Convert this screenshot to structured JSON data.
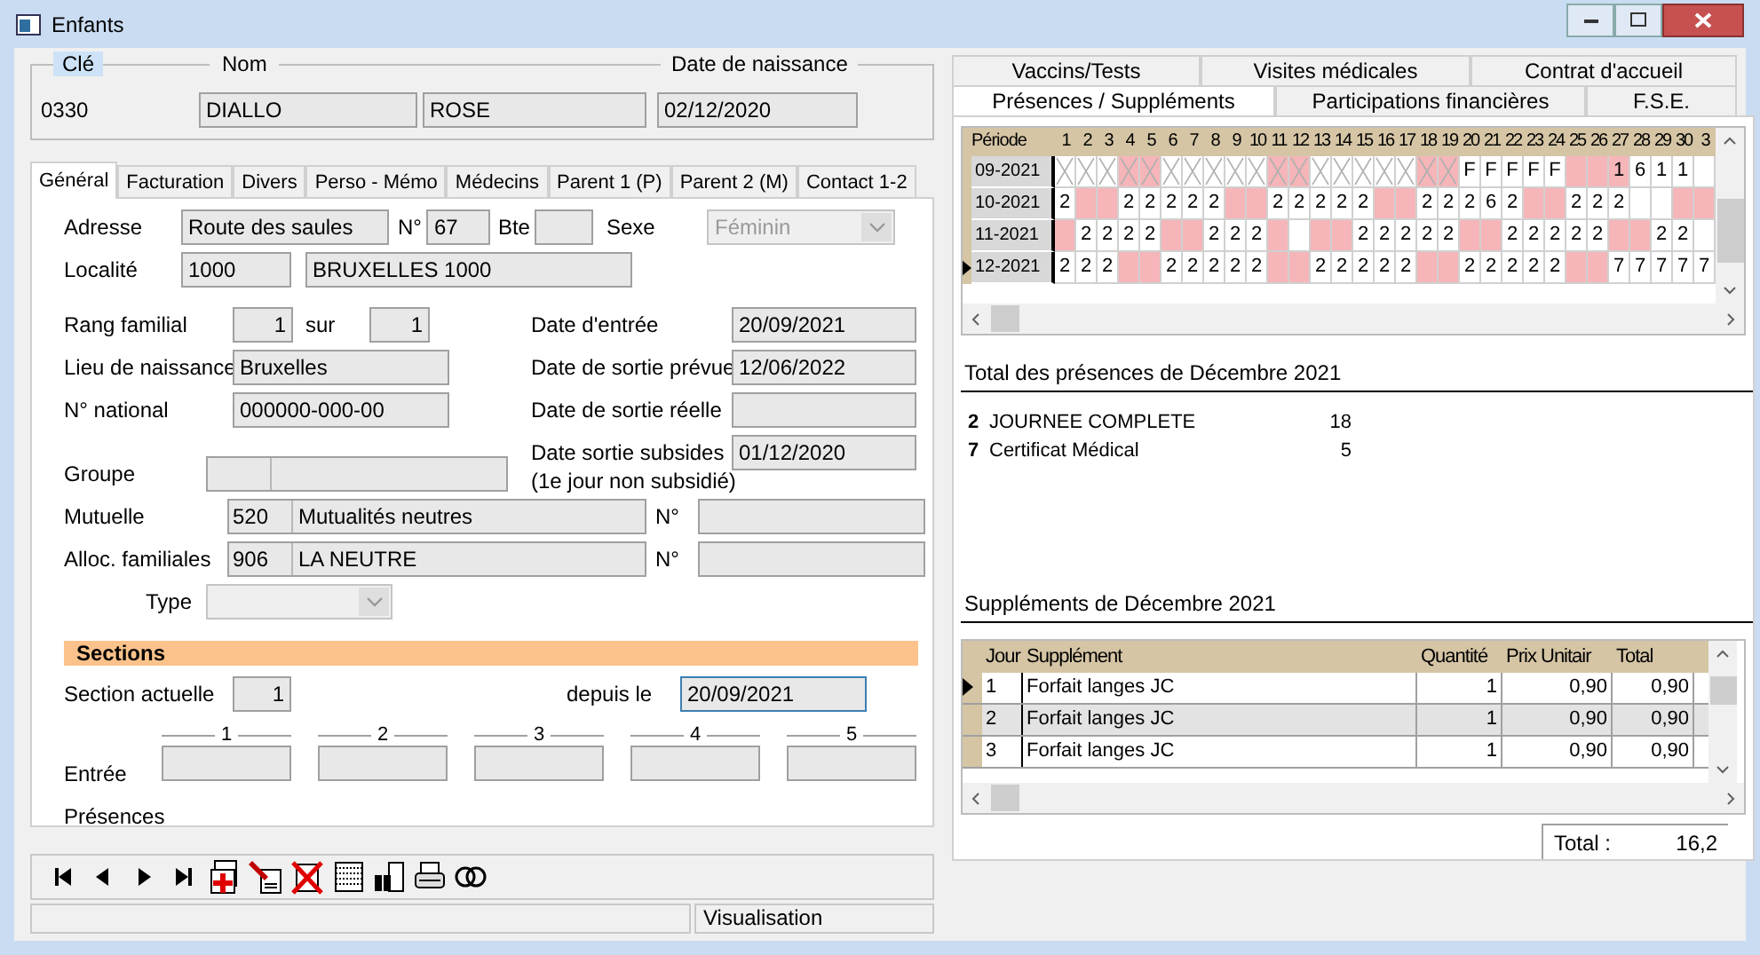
{
  "window": {
    "title": "Enfants"
  },
  "header": {
    "key_label": "Clé",
    "key_value": "0330",
    "name_label": "Nom",
    "last_name": "DIALLO",
    "first_name": "ROSE",
    "birth_label": "Date de naissance",
    "birth_date": "02/12/2020"
  },
  "tabs": [
    {
      "label": "Général",
      "selected": true
    },
    {
      "label": "Facturation",
      "selected": false
    },
    {
      "label": "Divers",
      "selected": false
    },
    {
      "label": "Perso - Mémo",
      "selected": false
    },
    {
      "label": "Médecins",
      "selected": false
    },
    {
      "label": "Parent 1 (P)",
      "selected": false
    },
    {
      "label": "Parent 2 (M)",
      "selected": false
    },
    {
      "label": "Contact 1-2",
      "selected": false
    }
  ],
  "general": {
    "address": {
      "label": "Adresse",
      "street": "Route des saules",
      "number_label": "N°",
      "number": "67",
      "box_label": "Bte",
      "sex_label": "Sexe",
      "sex": "Féminin",
      "sex_disabled": true
    },
    "locality": {
      "label": "Localité",
      "zip": "1000",
      "city": "BRUXELLES  1000"
    },
    "rank": {
      "label": "Rang familial",
      "value": "1",
      "of_label": "sur",
      "of": "1"
    },
    "birthplace": {
      "label": "Lieu de naissance",
      "value": "Bruxelles"
    },
    "national_number": {
      "label": "N° national",
      "value": "000000-000-00"
    },
    "dates": [
      {
        "label": "Date d'entrée",
        "value": "20/09/2021"
      },
      {
        "label": "Date de sortie prévue",
        "value": "12/06/2022"
      },
      {
        "label": "Date de sortie réelle"
      },
      {
        "label": "Date sortie subsides",
        "note": "(1e jour non subsidié)",
        "value": "01/12/2020"
      }
    ],
    "group": {
      "label": "Groupe"
    },
    "funds": [
      {
        "label": "Mutuelle",
        "code": "520",
        "name": "Mutualités neutres",
        "number_label": "N°"
      },
      {
        "label": "Alloc. familiales",
        "code": "906",
        "name": "LA NEUTRE",
        "number_label": "N°"
      }
    ],
    "type": {
      "label": "Type",
      "disabled": true
    },
    "sections": {
      "title": "Sections",
      "current_label": "Section actuelle",
      "current": "1",
      "since_label": "depuis le",
      "since": "20/09/2021",
      "columns": [
        "1",
        "2",
        "3",
        "4",
        "5"
      ],
      "entry_label": "Entrée",
      "presence_label": "Présences"
    }
  },
  "status_bar": {
    "mode": "Visualisation"
  },
  "right_tabs": [
    {
      "tabs": [
        {
          "label": "Vaccins/Tests",
          "selected": false
        },
        {
          "label": "Visites médicales",
          "selected": false
        },
        {
          "label": "Contrat d'accueil",
          "selected": false
        }
      ]
    },
    {
      "tabs": [
        {
          "label": "Présences / Suppléments",
          "selected": true
        },
        {
          "label": "Participations financières",
          "selected": false
        },
        {
          "label": "F.S.E.",
          "selected": false
        }
      ]
    }
  ],
  "presence_grid": {
    "period_label": "Période",
    "days": [
      "1",
      "2",
      "3",
      "4",
      "5",
      "6",
      "7",
      "8",
      "9",
      "10",
      "11",
      "12",
      "13",
      "14",
      "15",
      "16",
      "17",
      "18",
      "19",
      "20",
      "21",
      "22",
      "23",
      "24",
      "25",
      "26",
      "27",
      "28",
      "29",
      "30",
      "3"
    ],
    "rows": [
      {
        "period": "09-2021",
        "current": false,
        "cells": [
          {
            "kind": "closed"
          },
          {
            "kind": "closed"
          },
          {
            "kind": "closed"
          },
          {
            "kind": "closed_weekend"
          },
          {
            "kind": "closed_weekend"
          },
          {
            "kind": "closed"
          },
          {
            "kind": "closed"
          },
          {
            "kind": "closed"
          },
          {
            "kind": "closed"
          },
          {
            "kind": "closed"
          },
          {
            "kind": "closed_weekend"
          },
          {
            "kind": "closed_weekend"
          },
          {
            "kind": "closed"
          },
          {
            "kind": "closed"
          },
          {
            "kind": "closed"
          },
          {
            "kind": "closed"
          },
          {
            "kind": "closed"
          },
          {
            "kind": "closed_weekend"
          },
          {
            "kind": "closed_weekend"
          },
          {
            "kind": "open",
            "text": "F"
          },
          {
            "kind": "open",
            "text": "F"
          },
          {
            "kind": "open",
            "text": "F"
          },
          {
            "kind": "open",
            "text": "F"
          },
          {
            "kind": "open",
            "text": "F"
          },
          {
            "kind": "weekend"
          },
          {
            "kind": "weekend"
          },
          {
            "kind": "weekend",
            "text": "1"
          },
          {
            "kind": "open",
            "text": "6"
          },
          {
            "kind": "open",
            "text": "1"
          },
          {
            "kind": "open",
            "text": "1"
          },
          {
            "kind": "open"
          }
        ]
      },
      {
        "period": "10-2021",
        "current": false,
        "cells": [
          {
            "kind": "open",
            "text": "2"
          },
          {
            "kind": "weekend"
          },
          {
            "kind": "weekend"
          },
          {
            "kind": "open",
            "text": "2"
          },
          {
            "kind": "open",
            "text": "2"
          },
          {
            "kind": "open",
            "text": "2"
          },
          {
            "kind": "open",
            "text": "2"
          },
          {
            "kind": "open",
            "text": "2"
          },
          {
            "kind": "weekend"
          },
          {
            "kind": "weekend"
          },
          {
            "kind": "open",
            "text": "2"
          },
          {
            "kind": "open",
            "text": "2"
          },
          {
            "kind": "open",
            "text": "2"
          },
          {
            "kind": "open",
            "text": "2"
          },
          {
            "kind": "open",
            "text": "2"
          },
          {
            "kind": "weekend"
          },
          {
            "kind": "weekend"
          },
          {
            "kind": "open",
            "text": "2"
          },
          {
            "kind": "open",
            "text": "2"
          },
          {
            "kind": "open",
            "text": "2"
          },
          {
            "kind": "open",
            "text": "6"
          },
          {
            "kind": "open",
            "text": "2"
          },
          {
            "kind": "weekend"
          },
          {
            "kind": "weekend"
          },
          {
            "kind": "open",
            "text": "2"
          },
          {
            "kind": "open",
            "text": "2"
          },
          {
            "kind": "open",
            "text": "2"
          },
          {
            "kind": "open"
          },
          {
            "kind": "open"
          },
          {
            "kind": "weekend"
          },
          {
            "kind": "weekend"
          }
        ]
      },
      {
        "period": "11-2021",
        "current": false,
        "cells": [
          {
            "kind": "weekend"
          },
          {
            "kind": "open",
            "text": "2"
          },
          {
            "kind": "open",
            "text": "2"
          },
          {
            "kind": "open",
            "text": "2"
          },
          {
            "kind": "open",
            "text": "2"
          },
          {
            "kind": "weekend"
          },
          {
            "kind": "weekend"
          },
          {
            "kind": "open",
            "text": "2"
          },
          {
            "kind": "open",
            "text": "2"
          },
          {
            "kind": "open",
            "text": "2"
          },
          {
            "kind": "weekend"
          },
          {
            "kind": "open"
          },
          {
            "kind": "weekend"
          },
          {
            "kind": "weekend"
          },
          {
            "kind": "open",
            "text": "2"
          },
          {
            "kind": "open",
            "text": "2"
          },
          {
            "kind": "open",
            "text": "2"
          },
          {
            "kind": "open",
            "text": "2"
          },
          {
            "kind": "open",
            "text": "2"
          },
          {
            "kind": "weekend"
          },
          {
            "kind": "weekend"
          },
          {
            "kind": "open",
            "text": "2"
          },
          {
            "kind": "open",
            "text": "2"
          },
          {
            "kind": "open",
            "text": "2"
          },
          {
            "kind": "open",
            "text": "2"
          },
          {
            "kind": "open",
            "text": "2"
          },
          {
            "kind": "weekend"
          },
          {
            "kind": "weekend"
          },
          {
            "kind": "open",
            "text": "2"
          },
          {
            "kind": "open",
            "text": "2"
          },
          {
            "kind": "open"
          }
        ]
      },
      {
        "period": "12-2021",
        "current": true,
        "cells": [
          {
            "kind": "open",
            "text": "2"
          },
          {
            "kind": "open",
            "text": "2"
          },
          {
            "kind": "open",
            "text": "2"
          },
          {
            "kind": "weekend"
          },
          {
            "kind": "weekend"
          },
          {
            "kind": "open",
            "text": "2"
          },
          {
            "kind": "open",
            "text": "2"
          },
          {
            "kind": "open",
            "text": "2"
          },
          {
            "kind": "open",
            "text": "2"
          },
          {
            "kind": "open",
            "text": "2"
          },
          {
            "kind": "weekend"
          },
          {
            "kind": "weekend"
          },
          {
            "kind": "open",
            "text": "2"
          },
          {
            "kind": "open",
            "text": "2"
          },
          {
            "kind": "open",
            "text": "2"
          },
          {
            "kind": "open",
            "text": "2"
          },
          {
            "kind": "open",
            "text": "2"
          },
          {
            "kind": "weekend"
          },
          {
            "kind": "weekend"
          },
          {
            "kind": "open",
            "text": "2"
          },
          {
            "kind": "open",
            "text": "2"
          },
          {
            "kind": "open",
            "text": "2"
          },
          {
            "kind": "open",
            "text": "2"
          },
          {
            "kind": "open",
            "text": "2"
          },
          {
            "kind": "weekend"
          },
          {
            "kind": "weekend"
          },
          {
            "kind": "open",
            "text": "7"
          },
          {
            "kind": "open",
            "text": "7"
          },
          {
            "kind": "open",
            "text": "7"
          },
          {
            "kind": "open",
            "text": "7"
          },
          {
            "kind": "open",
            "text": "7"
          }
        ]
      }
    ]
  },
  "totals": {
    "title": "Total des présences de Décembre 2021",
    "items": [
      {
        "code": "2",
        "label": "JOURNEE COMPLETE",
        "count": "18"
      },
      {
        "code": "7",
        "label": "Certificat Médical",
        "count": "5"
      }
    ]
  },
  "supplements": {
    "title": "Suppléments de Décembre 2021",
    "columns": [
      "Jour",
      "Supplément",
      "Quantité",
      "Prix Unitair",
      "Total"
    ],
    "rows": [
      {
        "current": true,
        "shaded": false,
        "cells": [
          "1",
          "Forfait langes JC",
          "1",
          "0,90",
          "0,90"
        ]
      },
      {
        "current": false,
        "shaded": true,
        "cells": [
          "2",
          "Forfait langes JC",
          "1",
          "0,90",
          "0,90"
        ]
      },
      {
        "current": false,
        "shaded": false,
        "cells": [
          "3",
          "Forfait langes JC",
          "1",
          "0,90",
          "0,90"
        ]
      }
    ]
  },
  "total": {
    "label": "Total :",
    "value": "16,2"
  }
}
